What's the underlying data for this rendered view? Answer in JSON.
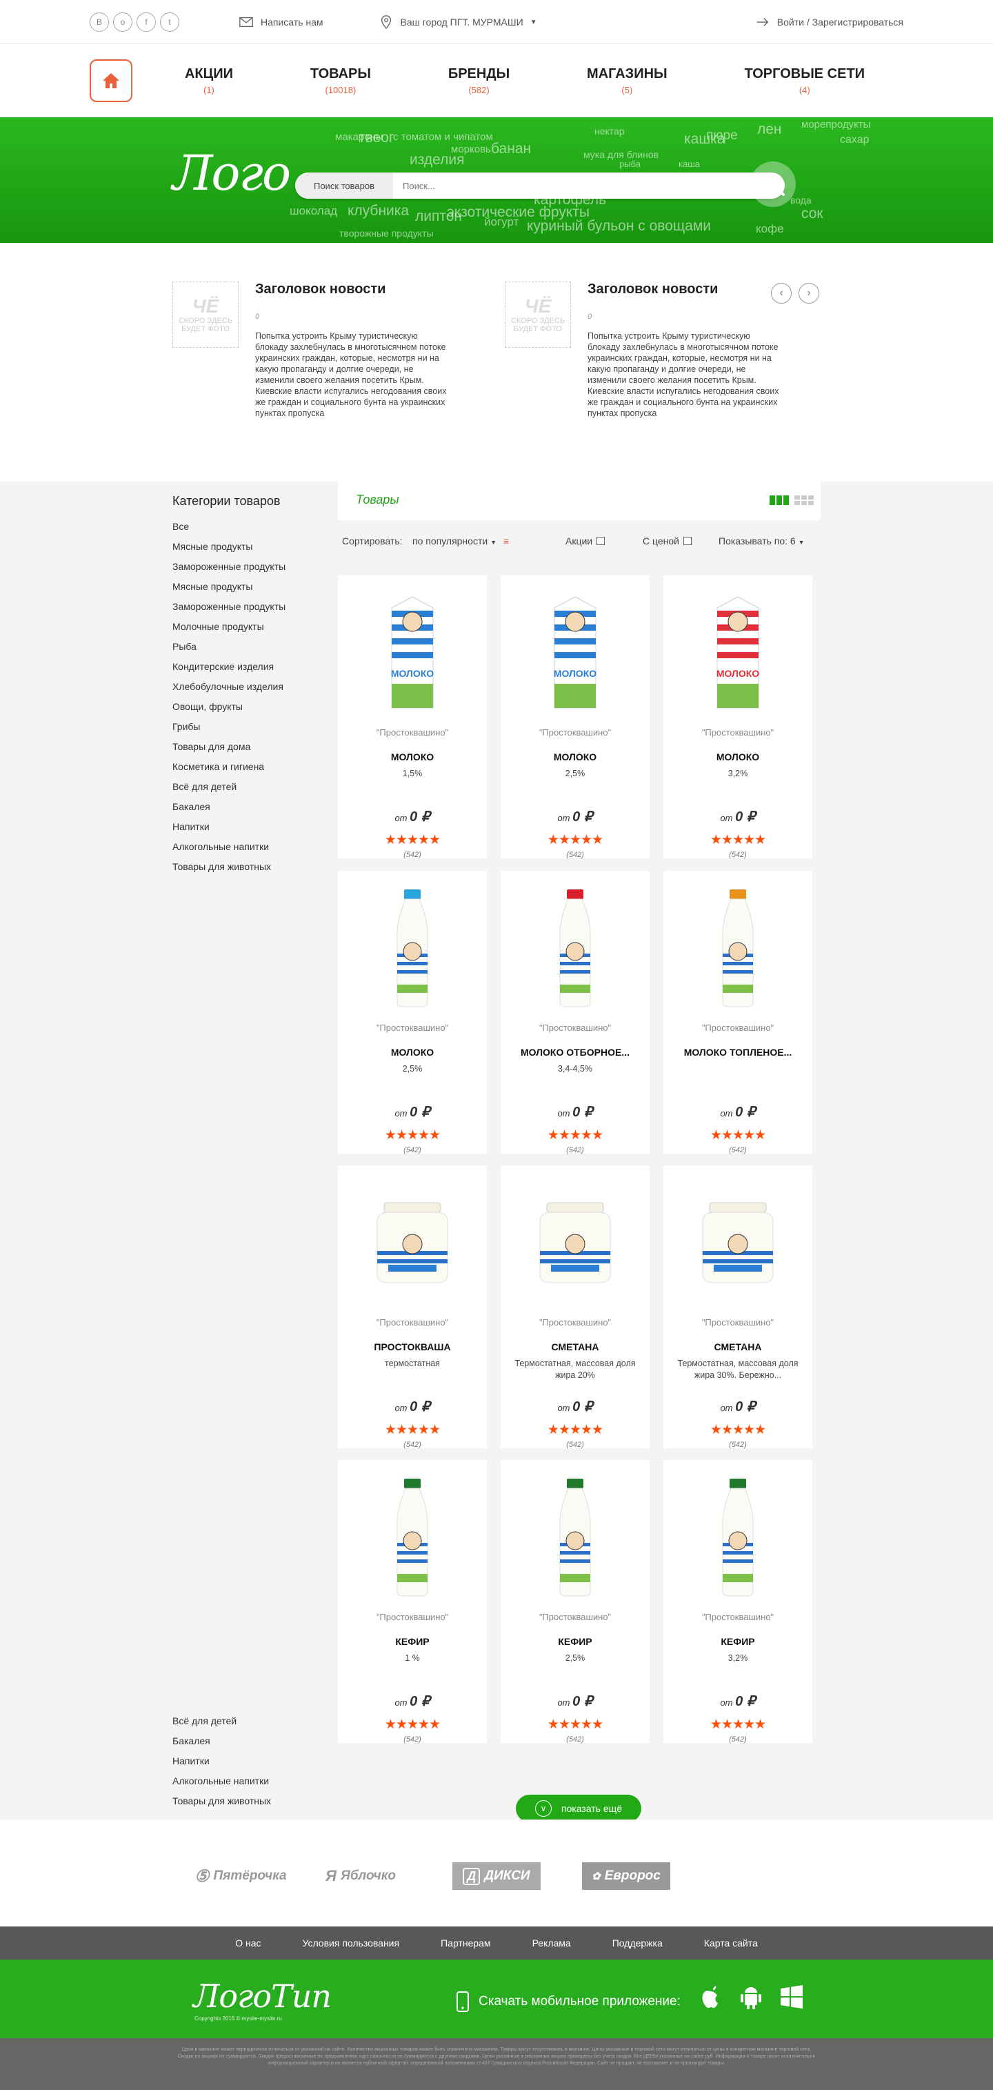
{
  "topbar": {
    "social": [
      "В",
      "о",
      "f",
      "t"
    ],
    "write_us": "Написать нам",
    "city_label": "Ваш город ПГТ. МУРМАШИ",
    "login": "Войти / Зарегистрироваться"
  },
  "nav": [
    {
      "label": "АКЦИИ",
      "count": "(1)"
    },
    {
      "label": "ТОВАРЫ",
      "count": "(10018)"
    },
    {
      "label": "БРЕНДЫ",
      "count": "(582)"
    },
    {
      "label": "МАГАЗИНЫ",
      "count": "(5)"
    },
    {
      "label": "ТОРГОВЫЕ СЕТИ",
      "count": "(4)"
    }
  ],
  "banner": {
    "logo": "Лого",
    "search_label": "Поиск товаров",
    "search_placeholder": "Поиск...",
    "cloud": [
      "макароны",
      "твеог",
      "с томатом и чипатом",
      "морковь",
      "банан",
      "изделия",
      "нектар",
      "кашка",
      "пюре",
      "лен",
      "морепродукты",
      "сахар",
      "мука для блинов",
      "каша",
      "картофель",
      "клубника",
      "экзотические фрукты",
      "липтон",
      "йогурт",
      "куриный бульон с овощами",
      "кофе",
      "сок",
      "творожные продукты",
      "шоколад",
      "вода",
      "рыба"
    ]
  },
  "news": [
    {
      "title": "Заголовок новости",
      "date": "0",
      "text": "Попытка устроить Крыму туристическую блокаду захлебнулась в многотысячном потоке украинских граждан, которые, несмотря ни на какую пропаганду и долгие очереди, не изменили своего желания посетить Крым. Киевские власти испугались негодования своих же граждан и социального бунта на украинских пунктах пропуска",
      "photo_text": "СКОРО ЗДЕСЬ БУДЕТ ФОТО",
      "photo_badge": "ЧЁ"
    },
    {
      "title": "Заголовок новости",
      "date": "0",
      "text": "Попытка устроить Крыму туристическую блокаду захлебнулась в многотысячном потоке украинских граждан, которые, несмотря ни на какую пропаганду и долгие очереди, не изменили своего желания посетить Крым. Киевские власти испугались негодования своих же граждан и социального бунта на украинских пунктах пропуска",
      "photo_text": "СКОРО ЗДЕСЬ БУДЕТ ФОТО",
      "photo_badge": "ЧЁ"
    }
  ],
  "sidebar": {
    "title": "Категории товаров",
    "items": [
      "Все",
      "Мясные продукты",
      "Замороженные продукты",
      "Мясные продукты",
      "Замороженные продукты",
      "Молочные продукты",
      "Рыба",
      "Кондитерские изделия",
      "Хлебобулочные изделия",
      "Овощи, фрукты",
      "Грибы",
      "Товары для дома",
      "Косметика и гигиена",
      "Всё для детей",
      "Бакалея",
      "Напитки",
      "Алкогольные напитки",
      "Товары для животных"
    ],
    "items_bottom": [
      "Всё для детей",
      "Бакалея",
      "Напитки",
      "Алкогольные напитки",
      "Товары для животных"
    ]
  },
  "catalog": {
    "tab": "Товары",
    "sort_label": "Сортировать:",
    "sort_value": "по популярности",
    "promo": "Акции",
    "with_price": "С ценой",
    "show_label": "Показывать по:",
    "show_value": "6",
    "more": "показать ещё",
    "products": [
      {
        "brand": "\"Простоквашино\"",
        "name": "МОЛОКО",
        "sub": "1,5%",
        "price_from": "от",
        "price": "0 ₽",
        "reviews": "(542)",
        "kind": "carton",
        "color": "#2a7fd4"
      },
      {
        "brand": "\"Простоквашино\"",
        "name": "МОЛОКО",
        "sub": "2,5%",
        "price_from": "от",
        "price": "0 ₽",
        "reviews": "(542)",
        "kind": "carton",
        "color": "#2a7fd4"
      },
      {
        "brand": "\"Простоквашино\"",
        "name": "МОЛОКО",
        "sub": "3,2%",
        "price_from": "от",
        "price": "0 ₽",
        "reviews": "(542)",
        "kind": "carton",
        "color": "#e0303a"
      },
      {
        "brand": "\"Простоквашино\"",
        "name": "МОЛОКО",
        "sub": "2,5%",
        "price_from": "от",
        "price": "0 ₽",
        "reviews": "(542)",
        "kind": "bottle",
        "color": "#2aa5dc"
      },
      {
        "brand": "\"Простоквашино\"",
        "name": "МОЛОКО ОТБОРНОЕ...",
        "sub": "3,4-4,5%",
        "price_from": "от",
        "price": "0 ₽",
        "reviews": "(542)",
        "kind": "bottle",
        "color": "#d8202a"
      },
      {
        "brand": "\"Простоквашино\"",
        "name": "МОЛОКО ТОПЛЕНОЕ...",
        "sub": "",
        "price_from": "от",
        "price": "0 ₽",
        "reviews": "(542)",
        "kind": "bottle",
        "color": "#e8921c"
      },
      {
        "brand": "\"Простоквашино\"",
        "name": "ПРОСТОКВАША",
        "sub": "термостатная",
        "price_from": "от",
        "price": "0 ₽",
        "reviews": "(542)",
        "kind": "jar",
        "color": "#2a7fd4"
      },
      {
        "brand": "\"Простоквашино\"",
        "name": "СМЕТАНА",
        "sub": "Термостатная, массовая доля жира 20%",
        "price_from": "от",
        "price": "0 ₽",
        "reviews": "(542)",
        "kind": "jar",
        "color": "#2a7fd4"
      },
      {
        "brand": "\"Простоквашино\"",
        "name": "СМЕТАНА",
        "sub": "Термостатная, массовая доля жира 30%. Бережно...",
        "price_from": "от",
        "price": "0 ₽",
        "reviews": "(542)",
        "kind": "jar",
        "color": "#2a7fd4"
      },
      {
        "brand": "\"Простоквашино\"",
        "name": "КЕФИР",
        "sub": "1 %",
        "price_from": "от",
        "price": "0 ₽",
        "reviews": "(542)",
        "kind": "kefir",
        "color": "#1e7a2a"
      },
      {
        "brand": "\"Простоквашино\"",
        "name": "КЕФИР",
        "sub": "2,5%",
        "price_from": "от",
        "price": "0 ₽",
        "reviews": "(542)",
        "kind": "kefir",
        "color": "#1e7a2a"
      },
      {
        "brand": "\"Простоквашино\"",
        "name": "КЕФИР",
        "sub": "3,2%",
        "price_from": "от",
        "price": "0 ₽",
        "reviews": "(542)",
        "kind": "kefir",
        "color": "#1e7a2a"
      }
    ]
  },
  "partners": [
    "Пятёрочка",
    "Яблочко",
    "ДИКСИ",
    "Евророс"
  ],
  "footer": {
    "menu": [
      "О нас",
      "Условия пользования",
      "Партнерам",
      "Реклама",
      "Поддержка",
      "Карта сайта"
    ],
    "logo": "ЛогоТип",
    "copyright": "Copyrights 2016 © mysite-mysite.ru",
    "app_label": "Скачать мобильное приложение:",
    "disclaimer": "Цена в магазине может переодически отличаться от указанной на сайте. Количество акционных товаров может быть ограничено магазином. Товары могут отсутствовать в магазине. Цены указанные в торговой сети могут отличаться от цены в конкретном магазине торговой сети. Скидки по акциям не суммируются. Скидки предоставляемые по предъявлению карт лояльности не суммируются с другими скидками. Цены указанные в рекламных акциях приведены без учета скидок. Все ЦЕНЫ указанные на сайте руб. Информация о товаре носит исключительно информационный характер и не является публичной офертой, определяемой положениями ст.437 Гражданского кодекса Российской Федерации. Сайт не продает, не поставляет и не производит товары."
  }
}
